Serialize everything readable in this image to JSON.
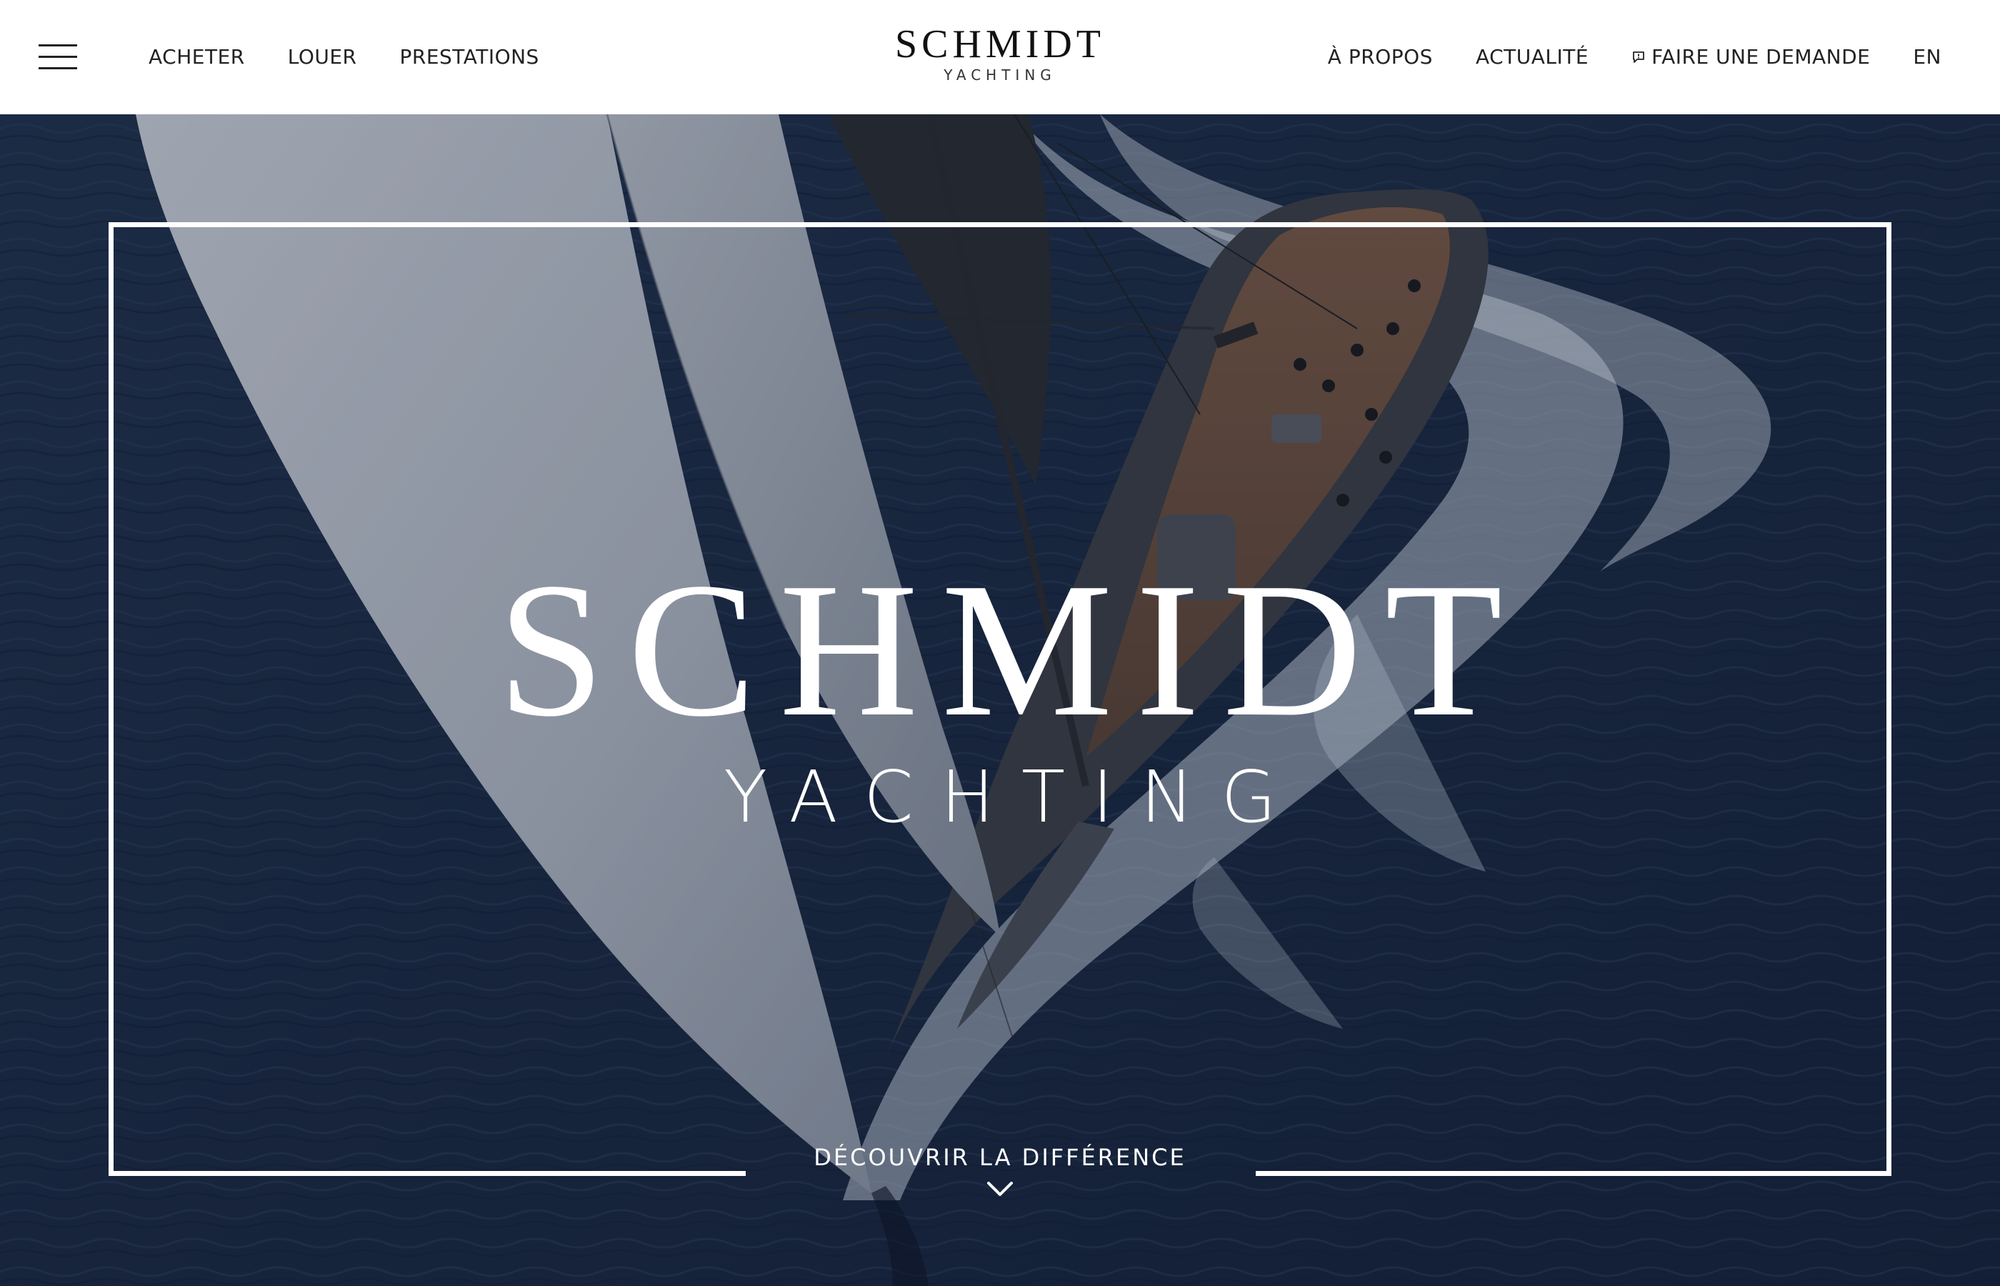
{
  "header": {
    "menu_icon": "hamburger-menu-icon",
    "nav_left": [
      "ACHETER",
      "LOUER",
      "PRESTATIONS"
    ],
    "logo": {
      "main": "SCHMIDT",
      "sub": "YACHTING"
    },
    "nav_right": {
      "about": "À PROPOS",
      "news": "ACTUALITÉ",
      "request_icon": "chat-bubble-icon",
      "request": "FAIRE UNE DEMANDE",
      "language": "EN"
    }
  },
  "hero": {
    "title": "SCHMIDT",
    "subtitle": "YACHTING",
    "cta": "DÉCOUVRIR LA DIFFÉRENCE",
    "cta_icon": "chevron-down-icon"
  },
  "colors": {
    "header_bg": "#ffffff",
    "text_dark": "#222222",
    "hero_text": "#ffffff",
    "sea": "#1d2e48"
  }
}
